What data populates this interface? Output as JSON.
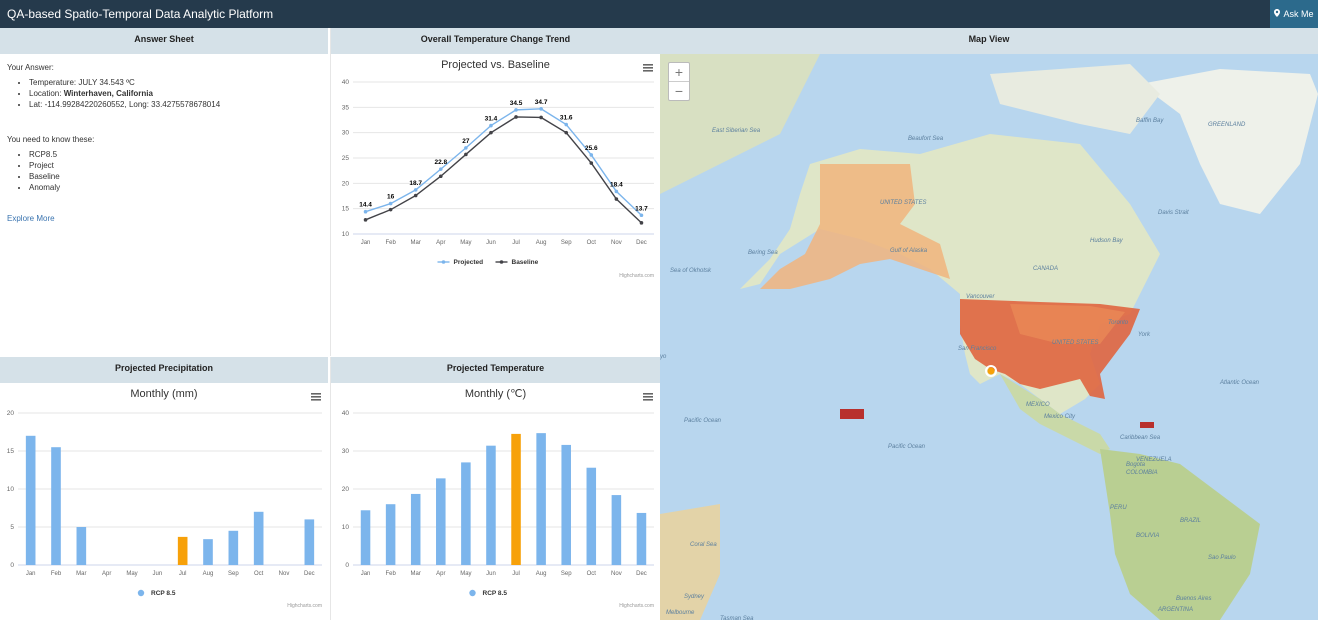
{
  "header": {
    "title": "QA-based Spatio-Temporal Data Analytic Platform",
    "ask_label": "Ask Me"
  },
  "answer_sheet": {
    "heading": "Answer Sheet",
    "your_answer": "Your Answer:",
    "temperature_prefix": "Temperature: ",
    "temperature_value": "JULY 34.543 ºC",
    "location_prefix": "Location: ",
    "location_value": "Winterhaven, California",
    "latlong": "Lat: -114.99284220260552, Long: 33.4275578678014",
    "need_to_know": "You need to know these:",
    "terms": [
      "RCP8.5",
      "Project",
      "Baseline",
      "Anomaly"
    ],
    "explore_more": "Explore More"
  },
  "months": [
    "Jan",
    "Feb",
    "Mar",
    "Apr",
    "May",
    "Jun",
    "Jul",
    "Aug",
    "Sep",
    "Oct",
    "Nov",
    "Dec"
  ],
  "trend_panel": {
    "heading": "Overall Temperature Change Trend",
    "credit": "Highcharts.com"
  },
  "precip_panel": {
    "heading": "Projected Precipitation",
    "credit": "Highcharts.com"
  },
  "temp_panel": {
    "heading": "Projected Temperature",
    "credit": "Highcharts.com"
  },
  "map_panel": {
    "heading": "Map View",
    "zoom_in": "+",
    "zoom_out": "−"
  },
  "chart_data": [
    {
      "type": "line",
      "title": "Projected vs. Baseline",
      "categories": [
        "Jan",
        "Feb",
        "Mar",
        "Apr",
        "May",
        "Jun",
        "Jul",
        "Aug",
        "Sep",
        "Oct",
        "Nov",
        "Dec"
      ],
      "ylim": [
        10,
        40
      ],
      "yticks": [
        10,
        15,
        20,
        25,
        30,
        35,
        40
      ],
      "legend": "bottom",
      "series": [
        {
          "name": "Projected",
          "color": "#7cb5ec",
          "values": [
            14.4,
            16,
            18.7,
            22.8,
            27,
            31.4,
            34.5,
            34.7,
            31.6,
            25.6,
            18.4,
            13.7
          ],
          "labels": [
            "14.4",
            "16",
            "18.7",
            "22.8",
            "27",
            "31.4",
            "34.5",
            "34.7",
            "31.6",
            "25.6",
            "18.4",
            "13.7"
          ]
        },
        {
          "name": "Baseline",
          "color": "#434348",
          "values": [
            12.8,
            14.8,
            17.6,
            21.4,
            25.7,
            30,
            33.1,
            33,
            30,
            24,
            16.9,
            12.2
          ]
        }
      ]
    },
    {
      "type": "bar",
      "title": "Monthly (mm)",
      "categories": [
        "Jan",
        "Feb",
        "Mar",
        "Apr",
        "May",
        "Jun",
        "Jul",
        "Aug",
        "Sep",
        "Oct",
        "Nov",
        "Dec"
      ],
      "ylim": [
        0,
        20
      ],
      "yticks": [
        0,
        5,
        10,
        15,
        20
      ],
      "legend": "bottom",
      "highlight_index": 6,
      "colors": {
        "base": "#7cb5ec",
        "highlight": "#f7a10a"
      },
      "series": [
        {
          "name": "RCP 8.5",
          "values": [
            17,
            15.5,
            5,
            0,
            0,
            0,
            3.7,
            3.4,
            4.5,
            7,
            0,
            6
          ]
        }
      ]
    },
    {
      "type": "bar",
      "title": "Monthly (℃)",
      "categories": [
        "Jan",
        "Feb",
        "Mar",
        "Apr",
        "May",
        "Jun",
        "Jul",
        "Aug",
        "Sep",
        "Oct",
        "Nov",
        "Dec"
      ],
      "ylim": [
        0,
        40
      ],
      "yticks": [
        0,
        10,
        20,
        30,
        40
      ],
      "legend": "bottom",
      "highlight_index": 6,
      "colors": {
        "base": "#7cb5ec",
        "highlight": "#f7a10a"
      },
      "series": [
        {
          "name": "RCP 8.5",
          "values": [
            14.4,
            16,
            18.7,
            22.8,
            27,
            31.4,
            34.5,
            34.7,
            31.6,
            25.6,
            18.4,
            13.7
          ]
        }
      ]
    }
  ],
  "map_labels": [
    "East Siberian Sea",
    "Beaufort Sea",
    "Baffin Bay",
    "GREENLAND",
    "UNITED STATES",
    "Bering Sea",
    "Gulf of Alaska",
    "Sea of Okhotsk",
    "Hudson Bay",
    "Davis Strait",
    "CANADA",
    "Vancouver",
    "San Francisco",
    "Toronto",
    "York",
    "UNITED STATES",
    "MEXICO",
    "Mexico City",
    "Caribbean Sea",
    "VENEZUELA",
    "Bogota",
    "COLOMBIA",
    "Atlantic Ocean",
    "Pacific Ocean",
    "Pacific Ocean",
    "PERU",
    "BRAZIL",
    "BOLIVIA",
    "Coral Sea",
    "Sao Paulo",
    "Sydney",
    "Buenos Aires",
    "Melbourne",
    "ARGENTINA",
    "Tasman Sea",
    "yo"
  ]
}
